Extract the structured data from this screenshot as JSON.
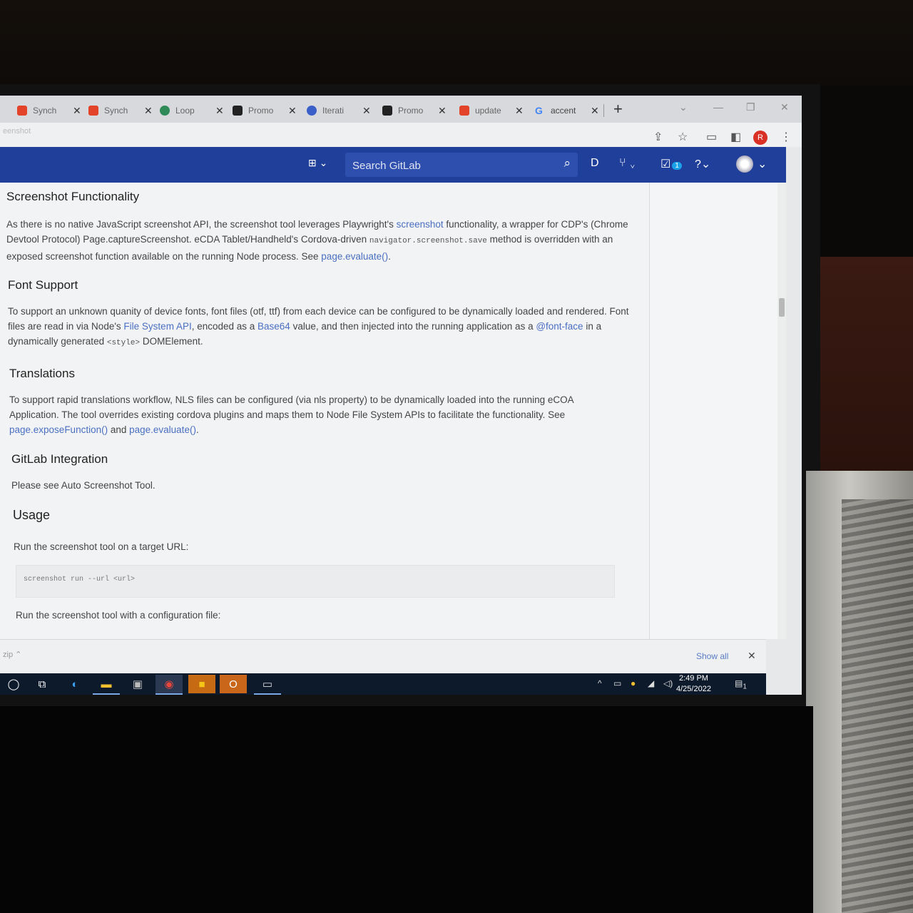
{
  "browser": {
    "tabs": [
      {
        "label": "Synch",
        "favicon": "gitlab-icon",
        "color": "#e24329"
      },
      {
        "label": "Synch",
        "favicon": "gitlab-icon",
        "color": "#e24329"
      },
      {
        "label": "Loop",
        "favicon": "loop-icon",
        "color": "#2e8b57"
      },
      {
        "label": "Promo",
        "favicon": "app-icon",
        "color": "#222222"
      },
      {
        "label": "Iterati",
        "favicon": "globe-icon",
        "color": "#3b5fc8"
      },
      {
        "label": "Promo",
        "favicon": "app-icon",
        "color": "#222222"
      },
      {
        "label": "update",
        "favicon": "gitlab-icon",
        "color": "#e24329"
      },
      {
        "label": "accent",
        "favicon": "google-icon",
        "color": "#4285f4"
      }
    ],
    "new_tab_label": "+",
    "address": "eenshot",
    "profile_initial": "R"
  },
  "gitlab": {
    "search_placeholder": "Search GitLab",
    "todo_badge": "1"
  },
  "doc": {
    "sections": [
      {
        "title": "Screenshot Functionality",
        "body": [
          "As there is no native JavaScript screenshot API, the screenshot tool leverages Playwright's ",
          "screenshot",
          " functionality, a wrapper for CDP's (Chrome Devtool Protocol) Page.captureScreenshot. eCDA Tablet/Handheld's Cordova-driven ",
          "navigator.screenshot.save",
          " method is overridden with an exposed screenshot function available on the running Node process. See ",
          "page.evaluate()",
          "."
        ]
      },
      {
        "title": "Font Support",
        "body": [
          "To support an unknown quanity of device fonts, font files (otf, ttf) from each device can be configured to be dynamically loaded and rendered. Font files are read in via Node's ",
          "File System API",
          ", encoded as a ",
          "Base64",
          " value, and then injected into the running application as a ",
          "@font-face",
          " in a dynamically generated ",
          "<style>",
          " DOMElement."
        ]
      },
      {
        "title": "Translations",
        "body": [
          "To support rapid translations workflow, NLS files can be configured (via nls property) to be dynamically loaded into the running eCOA Application. The tool overrides existing cordova plugins and maps them to Node File System APIs to facilitate the functionality. See ",
          "page.exposeFunction()",
          " and ",
          "page.evaluate()",
          "."
        ]
      },
      {
        "title": "GitLab Integration",
        "body": [
          "Please see Auto Screenshot Tool."
        ]
      },
      {
        "title": "Usage",
        "body": [
          "Run the screenshot tool on a target URL:"
        ]
      }
    ],
    "code_sample": "screenshot run --url <url>",
    "trailing_text": "Run the screenshot tool with a configuration file:"
  },
  "downloads": {
    "item_label": "zip",
    "show_all": "Show all"
  },
  "taskbar": {
    "time": "2:49 PM",
    "date": "4/25/2022",
    "notification_count": "1"
  },
  "colors": {
    "gitlab_nav": "#1f3f9a",
    "link": "#4a6fc2",
    "profile": "#d93025"
  }
}
